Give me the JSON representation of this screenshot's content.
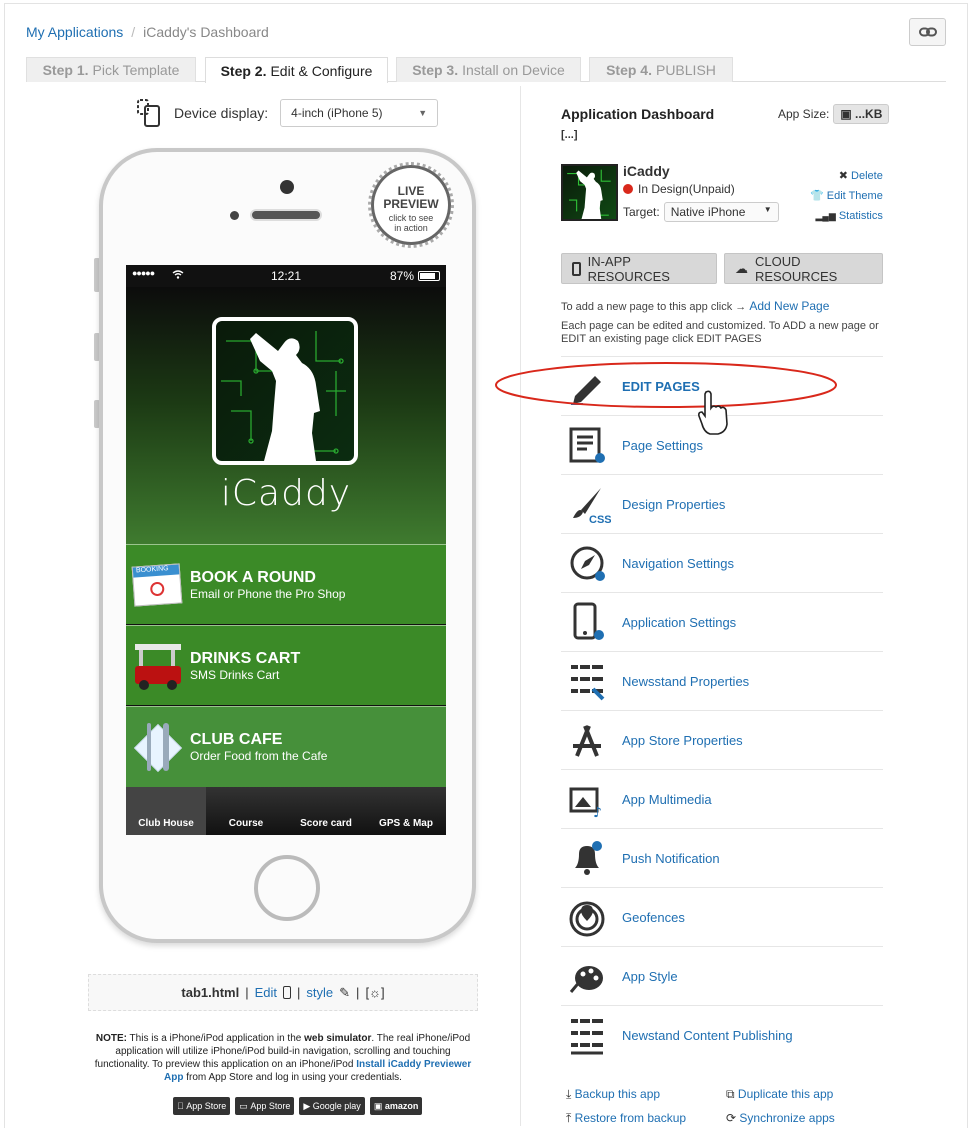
{
  "breadcrumb": {
    "link": "My Applications",
    "separator": "/",
    "current": "iCaddy's Dashboard"
  },
  "steps": [
    {
      "step": "Step 1.",
      "label": "Pick Template"
    },
    {
      "step": "Step 2.",
      "label": "Edit & Configure"
    },
    {
      "step": "Step 3.",
      "label": "Install on Device"
    },
    {
      "step": "Step 4.",
      "label": "PUBLISH"
    }
  ],
  "device": {
    "label": "Device display:",
    "selected": "4-inch (iPhone 5)"
  },
  "live_preview": {
    "line1": "LIVE",
    "line2": "PREVIEW",
    "line3": "click to see",
    "line4": "in action"
  },
  "phone_status": {
    "carrier": "●●●●●",
    "time": "12:21",
    "battery": "87%"
  },
  "app_screen": {
    "name": "iCaddy",
    "rows": [
      {
        "title": "BOOK A ROUND",
        "subtitle": "Email or Phone the Pro Shop",
        "icon_text": "BOOKING"
      },
      {
        "title": "DRINKS CART",
        "subtitle": "SMS Drinks Cart"
      },
      {
        "title": "CLUB CAFE",
        "subtitle": "Order Food from the Cafe"
      }
    ],
    "tabs": [
      "Club House",
      "Course",
      "Score card",
      "GPS & Map"
    ]
  },
  "filebar": {
    "file": "tab1.html",
    "edit": "Edit",
    "style": "style",
    "settings": "[☼]"
  },
  "note": {
    "prefix": "NOTE:",
    "text1": " This is a iPhone/iPod application in the ",
    "bold1": "web simulator",
    "text2": ". The real iPhone/iPod application will utilize iPhone/iPod build-in navigation, scrolling and touching functionality. To preview this application on an iPhone/iPod ",
    "link": "Install iCaddy Previewer App",
    "text3": " from App Store and log in using your credentials."
  },
  "stores": [
    "App Store",
    "App Store",
    "Google play",
    "amazon"
  ],
  "dashboard": {
    "title": "Application Dashboard",
    "ellipsis": "[...]",
    "app_size_label": "App Size:",
    "app_size": "...KB",
    "app_name": "iCaddy",
    "status": "In Design(Unpaid)",
    "target_label": "Target:",
    "target": "Native iPhone",
    "delete": "Delete",
    "edit_theme": "Edit Theme",
    "statistics": "Statistics",
    "btn_inapp": "IN-APP RESOURCES",
    "btn_cloud": "CLOUD RESOURCES",
    "help1": "To add a new page to this app click →",
    "help_link": "Add New Page",
    "help2": "Each page can be edited and customized. To ADD a new page or EDIT an existing page click EDIT PAGES",
    "menu": [
      "EDIT PAGES",
      "Page Settings",
      "Design Properties",
      "Navigation Settings",
      "Application Settings",
      "Newsstand Properties",
      "App Store Properties",
      "App Multimedia",
      "Push Notification",
      "Geofences",
      "App Style",
      "Newstand Content Publishing"
    ],
    "backup": "Backup this app",
    "restore": "Restore from backup",
    "duplicate": "Duplicate this app",
    "sync": "Synchronize apps"
  },
  "colors": {
    "link": "#1f6fb2",
    "green": "#3b8a27",
    "highlight": "#d9281b"
  }
}
